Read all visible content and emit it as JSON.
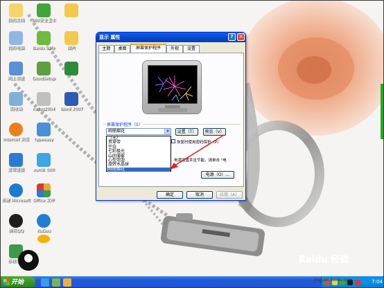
{
  "desktop_icons": [
    {
      "label": "我的文档",
      "name": "my-documents-icon",
      "color": "#f5d56a"
    },
    {
      "label": "360安全卫士",
      "name": "360-security-icon",
      "color": "#3fa63a"
    },
    {
      "label": "",
      "name": "folder-icon",
      "color": "#f2c94c"
    },
    {
      "label": "我的电脑",
      "name": "my-computer-icon",
      "color": "#8fb6e6"
    },
    {
      "label": "Baidu Safe",
      "name": "baidu-safe-icon",
      "color": "#6dbb3f"
    },
    {
      "label": "图片",
      "name": "pictures-folder-icon",
      "color": "#f2c94c"
    },
    {
      "label": "网上邻居",
      "name": "network-icon",
      "color": "#5b8fd6"
    },
    {
      "label": "GoodSetup",
      "name": "goodsetup-icon",
      "color": "#5f9e43"
    },
    {
      "label": "",
      "name": "excel-icon",
      "color": "#2e8b3a"
    },
    {
      "label": "回收站",
      "name": "recycle-bin-icon",
      "color": "#7fb0d8"
    },
    {
      "label": "netsg2004",
      "name": "netsg-icon",
      "color": "#c0c0c0"
    },
    {
      "label": "Word 2007",
      "name": "word-icon",
      "color": "#2b5bb5"
    },
    {
      "label": "Internet 浏览",
      "name": "internet-browser-icon",
      "color": "#f07d1a"
    },
    {
      "label": "typeeasy",
      "name": "typeeasy-icon",
      "color": "#4a8fd9"
    },
    {
      "label": "",
      "name": "",
      "color": ""
    },
    {
      "label": "宽带连接",
      "name": "broadband-icon",
      "color": "#2d7ad3"
    },
    {
      "label": "xunl8_000",
      "name": "xunlei-icon",
      "color": "#3da6e3"
    },
    {
      "label": "",
      "name": "",
      "color": ""
    },
    {
      "label": "新建 Microsoft",
      "name": "ms-shortcut-icon",
      "color": "#1b7ad3"
    },
    {
      "label": "Office 文件",
      "name": "office-file-icon",
      "color": "#f0a534"
    },
    {
      "label": "",
      "name": "",
      "color": ""
    },
    {
      "label": "腾讯QQ",
      "name": "qq-icon",
      "color": "#1e1e1e"
    },
    {
      "label": "KuGou",
      "name": "kugou-icon",
      "color": "#1f7fd6"
    },
    {
      "label": "",
      "name": "",
      "color": ""
    },
    {
      "label": "系统字典",
      "name": "dictionary-icon",
      "color": "#3b9b4a"
    },
    {
      "label": "",
      "name": "qq-chat-icon",
      "color": "#f5b300"
    },
    {
      "label": "",
      "name": "",
      "color": ""
    }
  ],
  "dialog": {
    "title": "显示 属性",
    "help": "?",
    "close": "✕",
    "tabs": [
      "主题",
      "桌面",
      "屏幕保护程序",
      "外观",
      "设置"
    ],
    "group_label": "屏幕保护程序（S）",
    "selected_saver": "绚丽烟花",
    "settings_button": "设置（T）",
    "preview_button": "预览（V）",
    "list_options": [
      "（无）",
      "贯穿带",
      "空白",
      "七彩极光",
      "山间薄雾",
      "心型泡泡",
      "旋转水晶球",
      "绚丽烟花"
    ],
    "selected_index": 7,
    "password_text": "恢复时使用密码保护（P）",
    "energy_text": "电源设置并且节能，请单击 \"电",
    "power_button": "电源（O）...",
    "ok_button": "确定",
    "cancel_button": "取消",
    "apply_button": "应用（A）"
  },
  "taskbar": {
    "start_label": "开始",
    "clock": "7:04"
  },
  "watermark": {
    "text": "Baidu 经验",
    "subtext": "jingyan.baidu.com"
  },
  "colors": {
    "titlebar": "#0a5ef0",
    "selection": "#316ac5",
    "taskbar": "#2357d4",
    "start": "#3a922c",
    "arrow": "#e02020"
  }
}
